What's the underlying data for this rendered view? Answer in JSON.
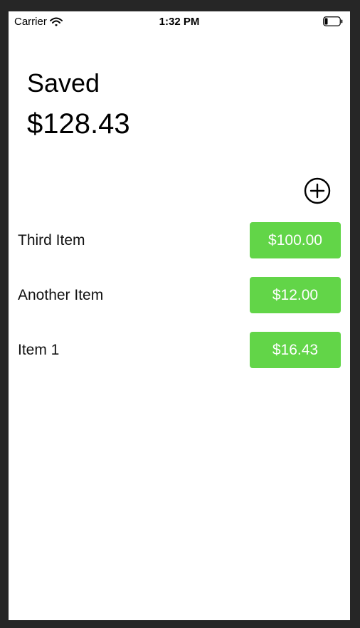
{
  "status_bar": {
    "carrier": "Carrier",
    "wifi_icon": "wifi-icon",
    "time": "1:32 PM",
    "battery_icon": "battery-low-icon"
  },
  "header": {
    "saved_label": "Saved",
    "saved_amount": "$128.43"
  },
  "add_button_icon": "plus-circle-icon",
  "items": [
    {
      "name": "Third Item",
      "price": "$100.00"
    },
    {
      "name": "Another Item",
      "price": "$12.00"
    },
    {
      "name": "Item 1",
      "price": "$16.43"
    }
  ],
  "colors": {
    "price_button": "#62d548",
    "background": "#ffffff",
    "frame": "#262626"
  }
}
